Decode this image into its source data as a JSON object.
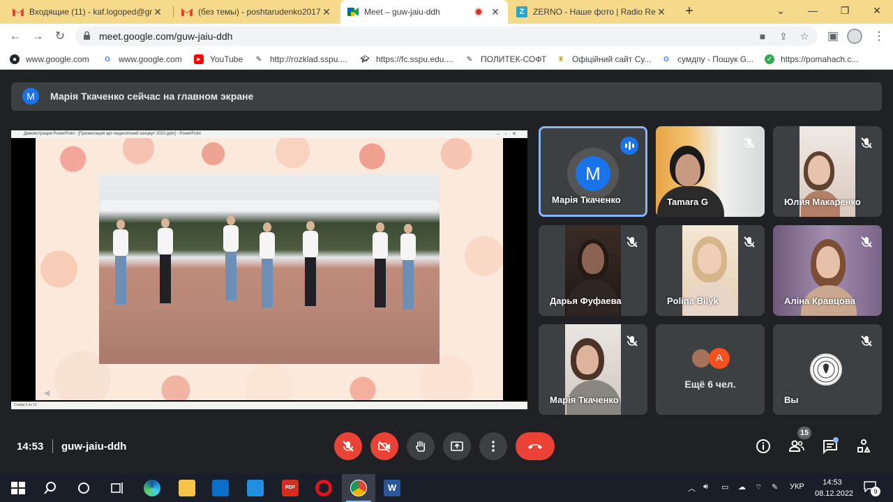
{
  "browser": {
    "tabs": [
      {
        "title": "Входящие (11) - kaf.logoped@gm",
        "icon": "gmail-icon"
      },
      {
        "title": "(без темы) - poshtarudenko2017",
        "icon": "gmail-icon"
      },
      {
        "title": "Meet – guw-jaiu-ddh",
        "icon": "meet-icon",
        "active": true
      },
      {
        "title": "ZERNO - Наше фото | Radio Rela",
        "icon": "zerno-icon"
      }
    ],
    "url": "meet.google.com/guw-jaiu-ddh",
    "bookmarks": [
      {
        "label": "www.google.com",
        "icon": "github-icon"
      },
      {
        "label": "www.google.com",
        "icon": "google-icon"
      },
      {
        "label": "YouTube",
        "icon": "youtube-icon"
      },
      {
        "label": "http://rozklad.sspu....",
        "icon": "bookmark-icon"
      },
      {
        "label": "https://fc.sspu.edu....",
        "icon": "graduation-cap-icon"
      },
      {
        "label": "ПОЛИТЕК-СОФТ",
        "icon": "bookmark-icon"
      },
      {
        "label": "Офіційний сайт Су...",
        "icon": "bookmark-icon"
      },
      {
        "label": "сумдпу - Пошук G...",
        "icon": "google-icon"
      },
      {
        "label": "https://pomahach.c...",
        "icon": "check-circle-icon"
      }
    ]
  },
  "meet": {
    "banner": {
      "avatar_letter": "M",
      "text": "Марія Ткаченко сейчас на главном экране"
    },
    "presentation": {
      "window_title": "Демонстрация PowerPoint - [Презентация арт-педагогічний концерт 2022.pptx] - PowerPoint",
      "status": "Слайд 9 из 10"
    },
    "tiles": [
      {
        "name": "Марія Ткаченко",
        "avatar_letter": "M",
        "speaking": true
      },
      {
        "name": "Tamara G"
      },
      {
        "name": "Юлия Макаренко"
      },
      {
        "name": "Дарья Фуфаева"
      },
      {
        "name": "Polina Bilyk"
      },
      {
        "name": "Аліна Кравцова"
      },
      {
        "name": "Марія Ткаченко"
      },
      {
        "name": "Ещё 6 чел.",
        "avatar_letter": "A"
      },
      {
        "name": "Вы"
      }
    ],
    "controls": {
      "time": "14:53",
      "meeting_code": "guw-jaiu-ddh",
      "participants_count": "15"
    },
    "colors": {
      "accent": "#1a73e8",
      "danger": "#ea4335",
      "tile_bg": "#3c4043",
      "bg": "#202124"
    }
  },
  "taskbar": {
    "language": "УКР",
    "time": "14:53",
    "date": "08.12.2022",
    "notifications": "9"
  }
}
